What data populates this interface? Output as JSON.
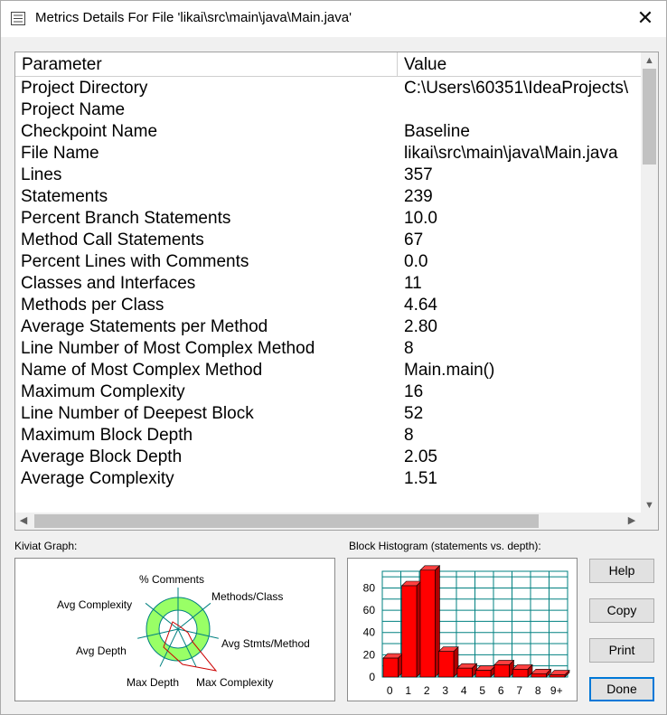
{
  "window": {
    "title": "Metrics Details For File 'likai\\src\\main\\java\\Main.java'",
    "close_symbol": "✕"
  },
  "table": {
    "headers": {
      "parameter": "Parameter",
      "value": "Value"
    },
    "rows": [
      {
        "parameter": "Project Directory",
        "value": "C:\\Users\\60351\\IdeaProjects\\"
      },
      {
        "parameter": "Project Name",
        "value": ""
      },
      {
        "parameter": "Checkpoint Name",
        "value": "Baseline"
      },
      {
        "parameter": "File Name",
        "value": "likai\\src\\main\\java\\Main.java"
      },
      {
        "parameter": "Lines",
        "value": "357"
      },
      {
        "parameter": "Statements",
        "value": "239"
      },
      {
        "parameter": "Percent Branch Statements",
        "value": "10.0"
      },
      {
        "parameter": "Method Call Statements",
        "value": "67"
      },
      {
        "parameter": "Percent Lines with Comments",
        "value": "0.0"
      },
      {
        "parameter": "Classes and Interfaces",
        "value": "11"
      },
      {
        "parameter": "Methods per Class",
        "value": "4.64"
      },
      {
        "parameter": "Average Statements per Method",
        "value": "2.80"
      },
      {
        "parameter": "Line Number of Most Complex Method",
        "value": "8"
      },
      {
        "parameter": "Name of Most Complex Method",
        "value": "Main.main()"
      },
      {
        "parameter": "Maximum Complexity",
        "value": "16"
      },
      {
        "parameter": "Line Number of Deepest Block",
        "value": "52"
      },
      {
        "parameter": "Maximum Block Depth",
        "value": "8"
      },
      {
        "parameter": "Average Block Depth",
        "value": "2.05"
      },
      {
        "parameter": "Average Complexity",
        "value": "1.51"
      }
    ]
  },
  "kiviat": {
    "label": "Kiviat Graph:",
    "axes": [
      "% Comments",
      "Methods/Class",
      "Avg Stmts/Method",
      "Max Complexity",
      "Max Depth",
      "Avg Depth",
      "Avg Complexity"
    ]
  },
  "histogram": {
    "label": "Block Histogram (statements vs. depth):"
  },
  "buttons": {
    "help": "Help",
    "copy": "Copy",
    "print": "Print",
    "done": "Done"
  },
  "colors": {
    "bar_fill": "#ff0000",
    "grid": "#008080",
    "kiviat_band": "#99ff66"
  },
  "chart_data": {
    "type": "bar",
    "categories": [
      "0",
      "1",
      "2",
      "3",
      "4",
      "5",
      "6",
      "7",
      "8",
      "9+"
    ],
    "values": [
      17,
      82,
      96,
      23,
      8,
      6,
      11,
      7,
      3,
      2
    ],
    "ylim": [
      0,
      95
    ],
    "yticks": [
      "0",
      "20",
      "40",
      "60",
      "80"
    ],
    "grid": true
  }
}
